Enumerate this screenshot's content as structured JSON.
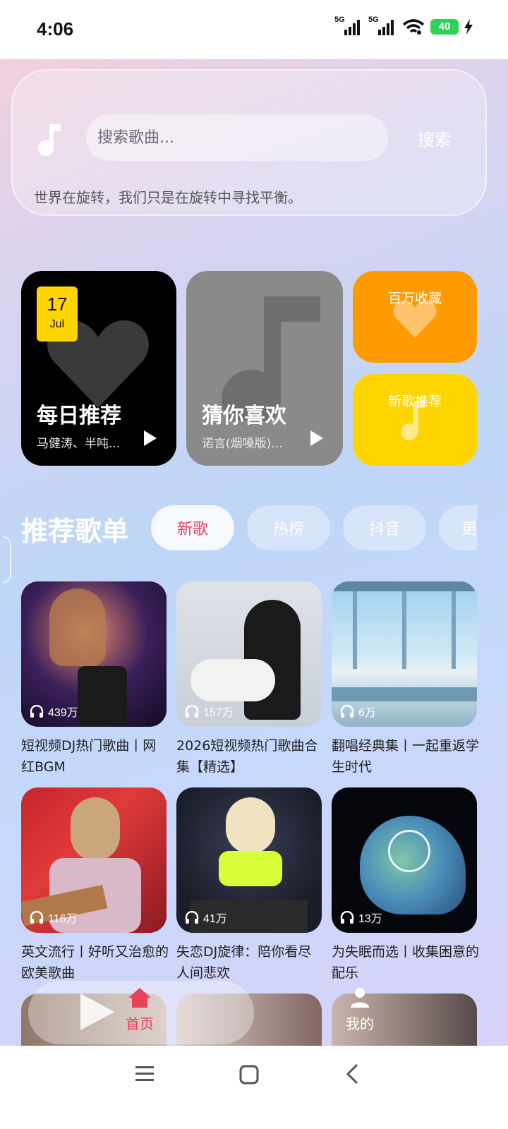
{
  "status_bar": {
    "time": "4:06",
    "signal1": "5G",
    "signal2": "5G",
    "battery": "40"
  },
  "search": {
    "placeholder": "搜索歌曲...",
    "button": "搜索",
    "slogan": "世界在旋转，我们只是在旋转中寻找平衡。"
  },
  "features": {
    "daily": {
      "title": "每日推荐",
      "subtitle": "马健涛、半吨...",
      "day": "17",
      "month": "Jul"
    },
    "guess": {
      "title": "猜你喜欢",
      "subtitle": "诺言(烟嗓版)..."
    },
    "million": {
      "title": "百万收藏"
    },
    "new_songs": {
      "title": "新歌推荐"
    }
  },
  "section": {
    "title": "推荐歌单",
    "tabs": [
      "新歌",
      "热榜",
      "抖音",
      "更"
    ]
  },
  "playlists": [
    {
      "plays": "439万",
      "title": "短视频DJ热门歌曲丨网红BGM"
    },
    {
      "plays": "157万",
      "title": "2026短视频热门歌曲合集【精选】"
    },
    {
      "plays": "6万",
      "title": "翻唱经典集丨一起重返学生时代"
    },
    {
      "plays": "116万",
      "title": "英文流行丨好听又治愈的欧美歌曲"
    },
    {
      "plays": "41万",
      "title": "失恋DJ旋律：陪你看尽人间悲欢"
    },
    {
      "plays": "13万",
      "title": "为失眠而选丨收集困意的配乐"
    }
  ],
  "bottom_nav": {
    "home": "首页",
    "mine": "我的"
  },
  "colors": {
    "accent": "#e8415c",
    "orange": "#ff9a00",
    "yellow": "#ffd400"
  }
}
